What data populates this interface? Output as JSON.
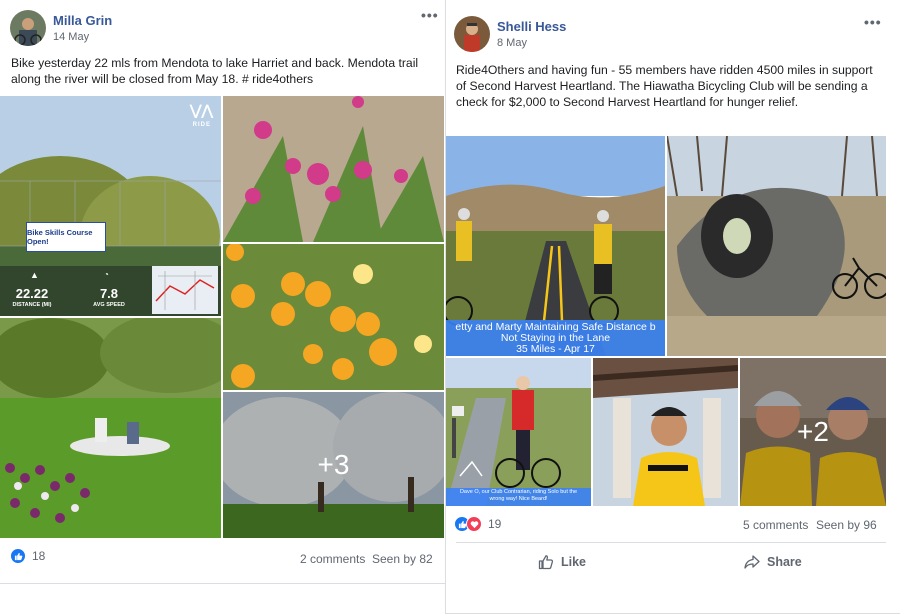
{
  "posts": [
    {
      "author": "Milla Grin",
      "date": "14 May",
      "text": "Bike yesterday 22 mls from Mendota to lake Harriet and back. Mendota trail along the river will be closed from May 18. # ride4others",
      "photo1": {
        "brand": "RIDE",
        "banner": "Bike Skills Course Open!",
        "distance_value": "22.22",
        "distance_label": "DISTANCE (MI)",
        "speed_value": "7.8",
        "speed_label": "AVG SPEED"
      },
      "more_photos": "+3",
      "reaction_count": "18",
      "comments": "2 comments",
      "seen": "Seen by 82"
    },
    {
      "author": "Shelli Hess",
      "date": "8 May",
      "text": "Ride4Others and having fun - 55 members have ridden 4500 miles in support of Second Harvest Heartland. The Hiawatha Bicycling Club will be sending a check for $2,000 to Second Harvest Heartland for hunger relief.",
      "photo1_caption": [
        "etty and Marty Maintaining Safe  Distance b",
        "Not Staying in the Lane",
        "35 Miles - Apr 17"
      ],
      "photo3_caption": [
        "Dave O, our Club Contrarian, riding Solo but the",
        "wrong way!  Nice Beard!"
      ],
      "more_photos": "+2",
      "reaction_count": "19",
      "comments": "5 comments",
      "seen": "Seen by 96",
      "like_label": "Like",
      "share_label": "Share"
    }
  ],
  "colors": {
    "link": "#385898",
    "like_blue": "#1877f2",
    "love_red": "#f33e58",
    "secondary_text": "#606770"
  }
}
